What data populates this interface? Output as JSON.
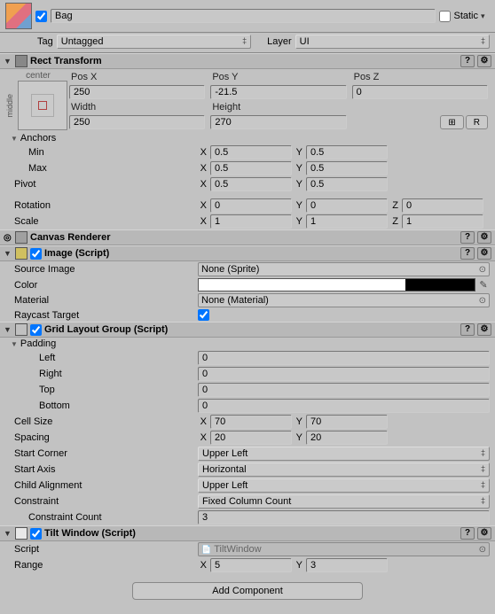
{
  "object": {
    "enabled": true,
    "name": "Bag",
    "static": false,
    "staticLabel": "Static",
    "tagLabel": "Tag",
    "tagValue": "Untagged",
    "layerLabel": "Layer",
    "layerValue": "UI"
  },
  "rectTransform": {
    "title": "Rect Transform",
    "anchorPreset": "center",
    "anchorPresetSide": "middle",
    "posX_label": "Pos X",
    "posY_label": "Pos Y",
    "posZ_label": "Pos Z",
    "posX": "250",
    "posY": "-21.5",
    "posZ": "0",
    "width_label": "Width",
    "height_label": "Height",
    "width": "250",
    "height": "270",
    "btn_blueprint": "⊞",
    "btn_raw": "R",
    "anchorsLabel": "Anchors",
    "minLabel": "Min",
    "minX": "0.5",
    "minY": "0.5",
    "maxLabel": "Max",
    "maxX": "0.5",
    "maxY": "0.5",
    "pivotLabel": "Pivot",
    "pivotX": "0.5",
    "pivotY": "0.5",
    "rotationLabel": "Rotation",
    "rotX": "0",
    "rotY": "0",
    "rotZ": "0",
    "scaleLabel": "Scale",
    "scaleX": "1",
    "scaleY": "1",
    "scaleZ": "1"
  },
  "canvasRenderer": {
    "title": "Canvas Renderer"
  },
  "image": {
    "title": "Image (Script)",
    "enabled": true,
    "sourceLabel": "Source Image",
    "sourceValue": "None (Sprite)",
    "colorLabel": "Color",
    "materialLabel": "Material",
    "materialValue": "None (Material)",
    "raycastLabel": "Raycast Target",
    "raycastValue": true
  },
  "gridLayout": {
    "title": "Grid Layout Group (Script)",
    "enabled": true,
    "paddingLabel": "Padding",
    "leftLabel": "Left",
    "left": "0",
    "rightLabel": "Right",
    "right": "0",
    "topLabel": "Top",
    "top": "0",
    "bottomLabel": "Bottom",
    "bottom": "0",
    "cellSizeLabel": "Cell Size",
    "cellX": "70",
    "cellY": "70",
    "spacingLabel": "Spacing",
    "spaceX": "20",
    "spaceY": "20",
    "startCornerLabel": "Start Corner",
    "startCorner": "Upper Left",
    "startAxisLabel": "Start Axis",
    "startAxis": "Horizontal",
    "childAlignLabel": "Child Alignment",
    "childAlign": "Upper Left",
    "constraintLabel": "Constraint",
    "constraint": "Fixed Column Count",
    "constraintCountLabel": "Constraint Count",
    "constraintCount": "3"
  },
  "tiltWindow": {
    "title": "Tilt Window (Script)",
    "enabled": true,
    "scriptLabel": "Script",
    "scriptValue": "TiltWindow",
    "rangeLabel": "Range",
    "rangeX": "5",
    "rangeY": "3"
  },
  "addComponent": "Add Component",
  "axis": {
    "x": "X",
    "y": "Y",
    "z": "Z"
  }
}
